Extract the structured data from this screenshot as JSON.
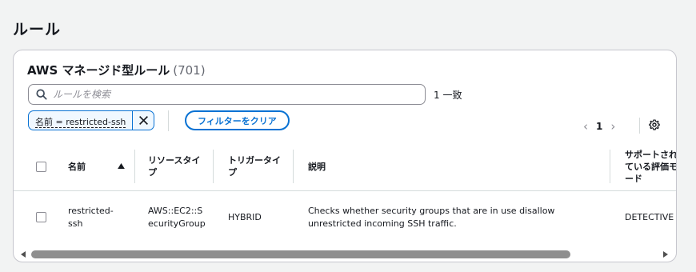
{
  "page_title": "ルール",
  "panel": {
    "title": "AWS マネージド型ルール",
    "count": "(701)"
  },
  "search": {
    "placeholder": "ルールを検索",
    "value": "",
    "match_count": "1 一致",
    "icon": "search-icon"
  },
  "filter_token": {
    "label": "名前 = restricted-ssh",
    "remove_icon": "close-icon"
  },
  "clear_filters_label": "フィルターをクリア",
  "pagination": {
    "prev_icon": "chevron-left-icon",
    "current_page": "1",
    "next_icon": "chevron-right-icon",
    "settings_icon": "gear-icon"
  },
  "table": {
    "columns": [
      "名前",
      "リソースタイプ",
      "トリガータイプ",
      "説明",
      "サポートされている評価モード"
    ],
    "sort_icon": "sort-ascending-icon",
    "rows": [
      {
        "name": "restricted-ssh",
        "resource_type": "AWS::EC2::SecurityGroup",
        "trigger_type": "HYBRID",
        "description": "Checks whether security groups that are in use disallow unrestricted incoming SSH traffic.",
        "evaluation_mode": "DETECTIVE"
      }
    ]
  },
  "colors": {
    "accent": "#0972d3",
    "token_background": "#f0f8ff",
    "page_background": "#f2f3f3",
    "text": "#16191f",
    "scrollbar_thumb": "#8f8f8f"
  }
}
